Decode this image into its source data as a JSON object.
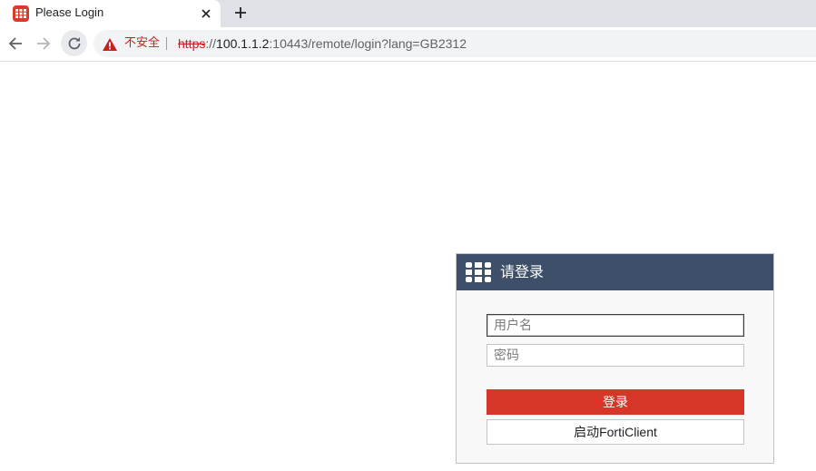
{
  "browser": {
    "tab": {
      "title": "Please Login"
    },
    "address": {
      "security_label": "不安全",
      "scheme": "https",
      "separator": "://",
      "host": "100.1.1.2",
      "rest": ":10443/remote/login?lang=GB2312"
    },
    "icons": {
      "favicon": "fortinet-favicon-icon",
      "close": "close-icon",
      "new_tab": "plus-icon",
      "back": "back-arrow-icon",
      "forward": "forward-arrow-icon",
      "reload": "reload-icon",
      "warning": "warning-triangle-icon"
    }
  },
  "login": {
    "title": "请登录",
    "username_placeholder": "用户名",
    "password_placeholder": "密码",
    "login_button": "登录",
    "forticlient_button": "启动FortiClient"
  },
  "colors": {
    "header": "#3e5069",
    "login_button": "#d63628",
    "insecure": "#c5221f"
  }
}
